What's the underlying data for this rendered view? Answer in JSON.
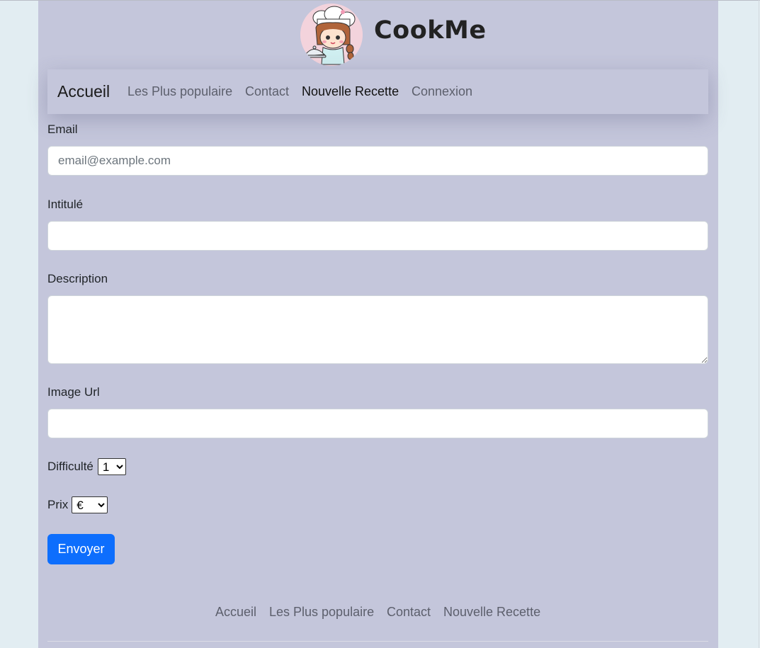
{
  "brand": {
    "name": "CookMe",
    "logo_icon": "chef-girl-logo-icon"
  },
  "navbar": {
    "brand": "Accueil",
    "links": [
      {
        "label": "Les Plus populaire",
        "active": false
      },
      {
        "label": "Contact",
        "active": false
      },
      {
        "label": "Nouvelle Recette",
        "active": true
      },
      {
        "label": "Connexion",
        "active": false
      }
    ]
  },
  "form": {
    "email": {
      "label": "Email",
      "placeholder": "email@example.com",
      "value": ""
    },
    "title": {
      "label": "Intitulé",
      "value": ""
    },
    "description": {
      "label": "Description",
      "value": ""
    },
    "image_url": {
      "label": "Image Url",
      "value": ""
    },
    "difficulty": {
      "label": "Difficulté",
      "selected": "1"
    },
    "price": {
      "label": "Prix",
      "selected": "€"
    },
    "submit_label": "Envoyer"
  },
  "footer": {
    "links": [
      "Accueil",
      "Les Plus populaire",
      "Contact",
      "Nouvelle Recette"
    ]
  },
  "colors": {
    "page_background": "#e2edf2",
    "container_background": "#c4c6db",
    "primary_button": "#0d6efd"
  }
}
